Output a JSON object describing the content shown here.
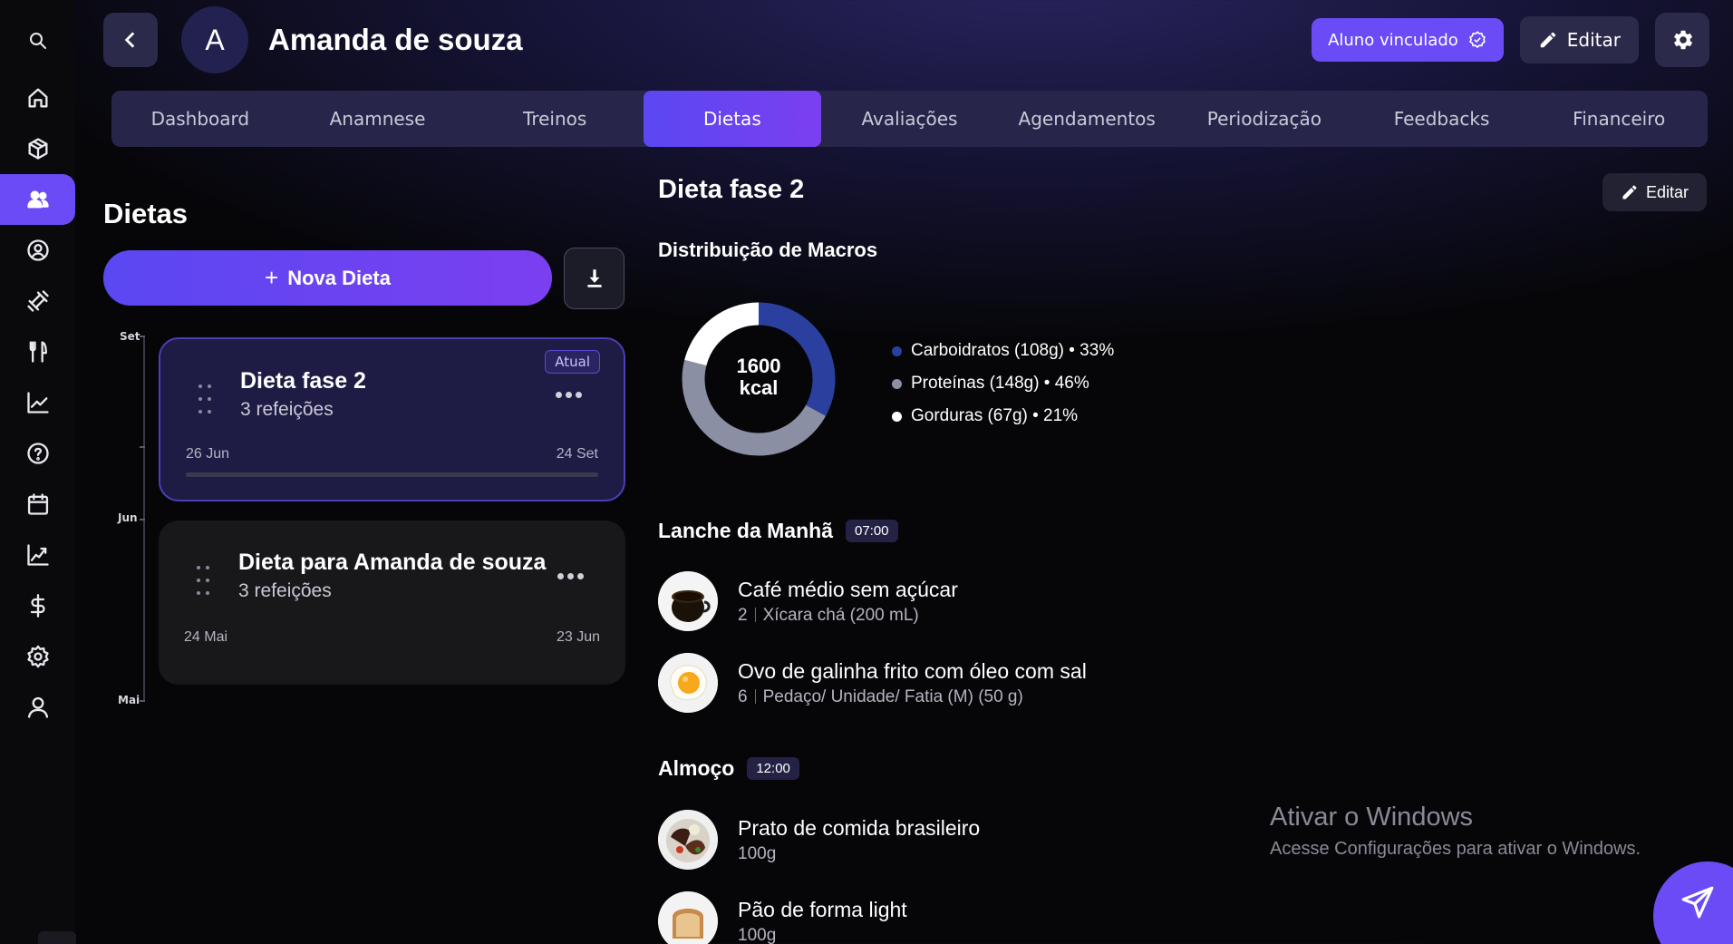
{
  "student": {
    "initial": "A",
    "name": "Amanda de souza"
  },
  "header": {
    "linked_label": "Aluno vinculado",
    "edit_label": "Editar"
  },
  "sidebar_icons": [
    "search-icon",
    "home-icon",
    "box-icon",
    "users-icon",
    "user-circle-icon",
    "dumbbell-icon",
    "fork-knife-icon",
    "chart-line-icon",
    "help-icon",
    "calendar-icon",
    "trending-icon",
    "dollar-icon",
    "settings-icon",
    "user-icon"
  ],
  "tabs": [
    {
      "label": "Dashboard"
    },
    {
      "label": "Anamnese"
    },
    {
      "label": "Treinos"
    },
    {
      "label": "Dietas",
      "active": true
    },
    {
      "label": "Avaliações"
    },
    {
      "label": "Agendamentos"
    },
    {
      "label": "Periodização"
    },
    {
      "label": "Feedbacks"
    },
    {
      "label": "Financeiro"
    }
  ],
  "diets_panel": {
    "title": "Dietas",
    "new_button": "Nova Dieta",
    "timeline": [
      "Set",
      "Jun",
      "Mai"
    ],
    "diets": [
      {
        "name": "Dieta fase 2",
        "meals": "3 refeições",
        "badge": "Atual",
        "start": "26 Jun",
        "end": "24 Set",
        "progress": 0
      },
      {
        "name": "Dieta para Amanda de souza",
        "meals": "3 refeições",
        "start": "24 Mai",
        "end": "23 Jun"
      }
    ]
  },
  "detail": {
    "title": "Dieta fase 2",
    "edit_label": "Editar",
    "macros_title": "Distribuição de Macros",
    "kcal_value": "1600",
    "kcal_unit": "kcal",
    "macros": [
      {
        "label": "Carboidratos (108g) • 33%",
        "percent": 33,
        "color": "#2b3f9e"
      },
      {
        "label": "Proteínas (148g) • 46%",
        "percent": 46,
        "color": "#8a8fa3"
      },
      {
        "label": "Gorduras (67g) • 21%",
        "percent": 21,
        "color": "#ffffff"
      }
    ],
    "meals": [
      {
        "name": "Lanche da Manhã",
        "time": "07:00",
        "foods": [
          {
            "name": "Café médio sem açúcar",
            "qty": "2",
            "unit": "Xícara chá (200 mL)",
            "icon": "coffee-cup"
          },
          {
            "name": "Ovo de galinha frito com óleo com sal",
            "qty": "6",
            "unit": "Pedaço/ Unidade/ Fatia (M) (50 g)",
            "icon": "fried-egg"
          }
        ]
      },
      {
        "name": "Almoço",
        "time": "12:00",
        "foods": [
          {
            "name": "Prato de comida brasileiro",
            "qty": "100g",
            "icon": "brazilian-plate"
          },
          {
            "name": "Pão de forma light",
            "qty": "100g",
            "icon": "bread-loaf"
          }
        ]
      }
    ]
  },
  "watermark": {
    "title": "Ativar o Windows",
    "subtitle": "Acesse Configurações para ativar o Windows."
  }
}
